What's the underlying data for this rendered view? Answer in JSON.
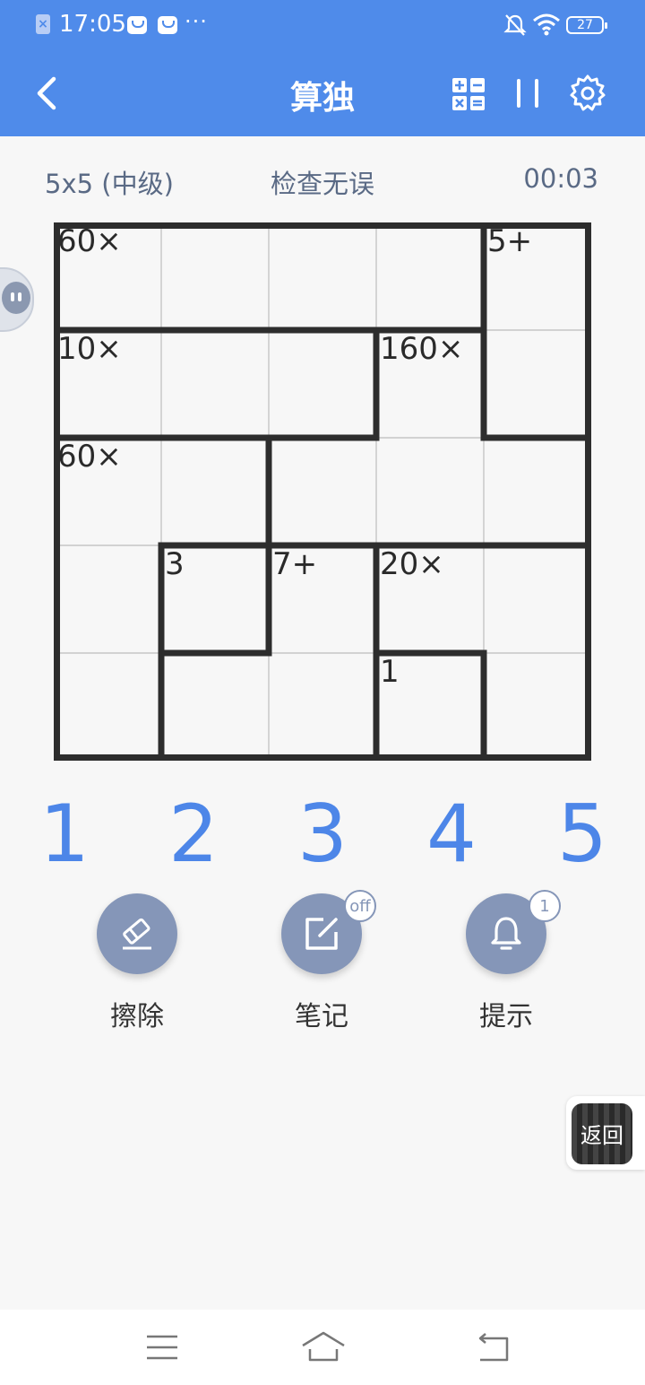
{
  "status_bar": {
    "time": "17:05",
    "more": "···",
    "battery": "27",
    "icons": [
      "notification-x-icon",
      "message-icon",
      "message-icon",
      "mute-icon",
      "wifi-icon",
      "battery-icon"
    ]
  },
  "app_bar": {
    "title": "算独",
    "icons": [
      "back-icon",
      "calculator-icon",
      "pause-icon",
      "gear-icon"
    ]
  },
  "info": {
    "size": "5x5 (中级)",
    "status": "检查无误",
    "timer": "00:03"
  },
  "grid": {
    "size": 5,
    "cages": [
      {
        "label": "60×",
        "row": 0,
        "col": 0
      },
      {
        "label": "5+",
        "row": 0,
        "col": 4
      },
      {
        "label": "10×",
        "row": 1,
        "col": 0
      },
      {
        "label": "160×",
        "row": 1,
        "col": 3
      },
      {
        "label": "60×",
        "row": 2,
        "col": 0
      },
      {
        "label": "3",
        "row": 3,
        "col": 1
      },
      {
        "label": "7+",
        "row": 3,
        "col": 2
      },
      {
        "label": "20×",
        "row": 3,
        "col": 3
      },
      {
        "label": "1",
        "row": 4,
        "col": 3
      }
    ]
  },
  "numpad": [
    "1",
    "2",
    "3",
    "4",
    "5"
  ],
  "tools": {
    "erase": {
      "label": "擦除"
    },
    "notes": {
      "label": "笔记",
      "badge": "off"
    },
    "hint": {
      "label": "提示",
      "badge": "1"
    }
  },
  "return_button": {
    "label": "返回"
  },
  "colors": {
    "accent": "#4f8bea",
    "numpad": "#4d86e8",
    "tool_circle": "#8596b8"
  }
}
